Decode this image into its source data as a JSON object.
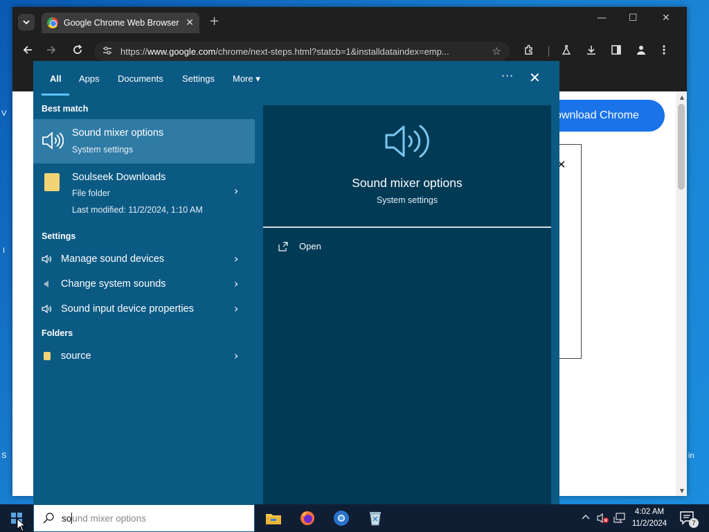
{
  "desktop": {
    "left_labels": [
      "V",
      "S",
      "I"
    ],
    "right_label": "in"
  },
  "chrome": {
    "tab_title": "Google Chrome Web Browser",
    "tab_close": "✕",
    "new_tab": "+",
    "url_prefix": "https://",
    "url_domain": "www.google.com",
    "url_rest": "/chrome/next-steps.html?statcb=1&installdataindex=emp...",
    "window_controls": [
      "—",
      "☐",
      "✕"
    ]
  },
  "page": {
    "download_button": "ownload Chrome",
    "dialog_close": "✕"
  },
  "search": {
    "tabs": [
      "All",
      "Apps",
      "Documents",
      "Settings",
      "More ▾"
    ],
    "more_options": "···",
    "close": "✕",
    "sections": {
      "best_match": "Best match",
      "settings": "Settings",
      "folders": "Folders"
    },
    "best_match": {
      "title": "Sound mixer options",
      "subtitle": "System settings"
    },
    "soulseek": {
      "title": "Soulseek Downloads",
      "subtitle": "File folder",
      "modified": "Last modified: 11/2/2024, 1:10 AM"
    },
    "settings_items": [
      {
        "label": "Manage sound devices",
        "icon": "speaker-icon"
      },
      {
        "label": "Change system sounds",
        "icon": "speaker-small-icon"
      },
      {
        "label": "Sound input device properties",
        "icon": "speaker-icon"
      }
    ],
    "folder_item": {
      "label": "source",
      "icon": "folder-icon"
    },
    "preview": {
      "title": "Sound mixer options",
      "subtitle": "System settings",
      "action": "Open"
    },
    "chevron": "›"
  },
  "taskbar": {
    "search_typed": "so",
    "search_suggestion": "und mixer options",
    "time": "4:02 AM",
    "date": "11/2/2024",
    "notification_count": "7",
    "apps": [
      "file-explorer-icon",
      "firefox-icon",
      "chrome-icon",
      "recycle-bin-icon"
    ]
  },
  "colors": {
    "panel_bg": "#0b5a84",
    "preview_bg": "#013a55",
    "highlight": "#2f7ba5",
    "taskbar_bg": "#101e33",
    "accent_blue": "#1a73e8"
  }
}
